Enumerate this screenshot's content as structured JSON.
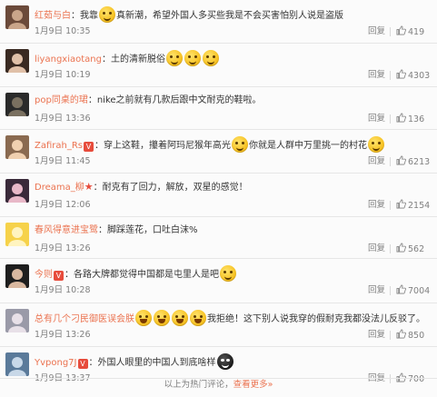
{
  "comments": [
    {
      "name": "红茹与白",
      "badge": "",
      "sep": "：",
      "text_before": "我靠",
      "emoji": "smile",
      "text_after": "真新潮，希望外国人多买些我是不会买害怕别人说是盗版",
      "time": "1月9日 10:35",
      "reply": "回复",
      "likes": "419",
      "avatar_colors": [
        "#6b4a3a",
        "#c9a58a"
      ]
    },
    {
      "name": "liyangxiaotang",
      "badge": "",
      "sep": "：",
      "text_before": "土的清新脱俗",
      "emoji": "smile3",
      "text_after": "",
      "time": "1月9日 10:19",
      "reply": "回复",
      "likes": "4303",
      "avatar_colors": [
        "#3a2a22",
        "#e0c0a8"
      ]
    },
    {
      "name": "pop同桌的珺",
      "badge": "",
      "sep": "：",
      "text_before": "nike之前就有几款后跟中文耐克的鞋啦。",
      "emoji": "",
      "text_after": "",
      "time": "1月9日 13:36",
      "reply": "回复",
      "likes": "136",
      "avatar_colors": [
        "#2a2a2a",
        "#7a7060"
      ]
    },
    {
      "name": "Zafirah_Rs",
      "badge": "V",
      "sep": "：",
      "text_before": "穿上这鞋，攥着阿玛尼猴年高光",
      "emoji": "smile",
      "text_after": "你就是人群中万里挑一的村花",
      "emoji2": "smile",
      "time": "1月9日 11:45",
      "reply": "回复",
      "likes": "6213",
      "avatar_colors": [
        "#8a6a50",
        "#f0d0b0"
      ]
    },
    {
      "name": "Dreama_柳",
      "badge": "★",
      "sep": "：",
      "text_before": "耐克有了回力，解放，双星的感觉！",
      "emoji": "",
      "text_after": "",
      "time": "1月9日 12:06",
      "reply": "回复",
      "likes": "2154",
      "avatar_colors": [
        "#3a2a3a",
        "#e8b8c8"
      ]
    },
    {
      "name": "春风得意进宝鹭",
      "badge": "",
      "sep": "：",
      "text_before": "脚踩莲花，口吐白沫%",
      "emoji": "",
      "text_after": "",
      "time": "1月9日 13:26",
      "reply": "回复",
      "likes": "562",
      "avatar_colors": [
        "#f6d24a",
        "#fff4c0"
      ]
    },
    {
      "name": "今则",
      "badge": "V",
      "sep": "：",
      "text_before": "各路大牌都觉得中国都是屯里人是吧",
      "emoji": "smile",
      "text_after": "",
      "time": "1月9日 10:28",
      "reply": "回复",
      "likes": "7004",
      "avatar_colors": [
        "#1e1e1e",
        "#d8b8a0"
      ]
    },
    {
      "name": "总有几个刁民御医误会朕",
      "badge": "",
      "sep": "",
      "text_before": "",
      "emoji": "laugh4",
      "text_after": "我拒绝！这下别人说我穿的假耐克我都没法儿反驳了。",
      "time": "1月9日 13:26",
      "reply": "回复",
      "likes": "850",
      "avatar_colors": [
        "#9a9aa8",
        "#e8e0e8"
      ]
    },
    {
      "name": "Yvpong7J",
      "badge": "V",
      "sep": "：",
      "text_before": "外国人眼里的中国人到底啥样",
      "emoji": "black",
      "text_after": "",
      "time": "1月9日 13:37",
      "reply": "回复",
      "likes": "700",
      "avatar_colors": [
        "#5a7a9a",
        "#c8d8e8"
      ]
    }
  ],
  "footer": {
    "text": "以上为热门评论，",
    "more": "查看更多»"
  },
  "colors": {
    "name": "#eb7350",
    "meta": "#808080",
    "divider": "#e6e6e6",
    "badge": "#e74c3c"
  },
  "icons": {
    "like": "thumbs-up-icon"
  }
}
